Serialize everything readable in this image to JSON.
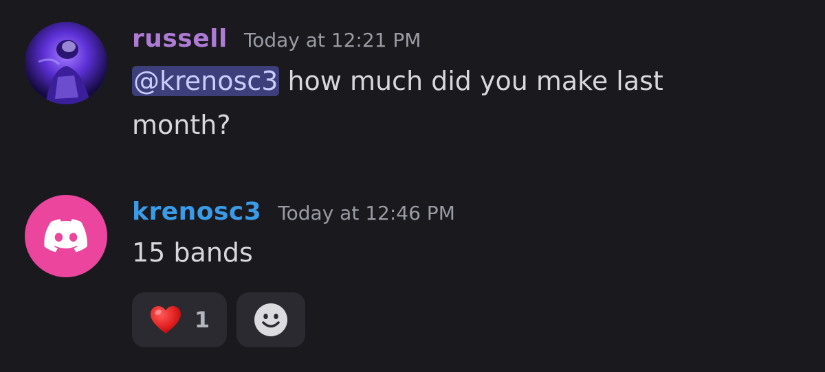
{
  "messages": [
    {
      "username": "russell",
      "username_color": "#b07bd6",
      "timestamp": "Today at 12:21 PM",
      "mention": "@krenosc3",
      "text": " how much did you make last month?",
      "avatar_icon": "user-photo-avatar"
    },
    {
      "username": "krenosc3",
      "username_color": "#3a9be8",
      "timestamp": "Today at 12:46 PM",
      "text": "15 bands",
      "avatar_icon": "discord-logo-icon",
      "avatar_color": "#eb459e",
      "reactions": [
        {
          "emoji": "❤️",
          "count": "1"
        }
      ],
      "add_reaction_icon": "smiley-face-icon"
    }
  ]
}
